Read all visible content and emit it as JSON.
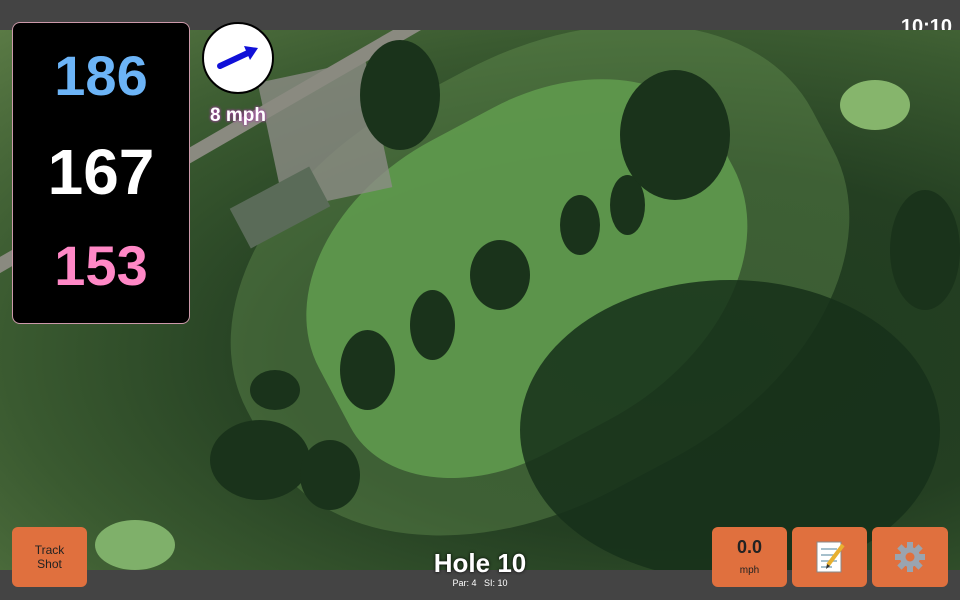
{
  "status": {
    "time": "10:10"
  },
  "yardages": {
    "back": "186",
    "middle": "167",
    "front": "153"
  },
  "wind": {
    "speed": "8 mph",
    "icon": "wind-arrow-icon"
  },
  "hole": {
    "title": "Hole 10",
    "par_label": "Par: 4",
    "si_label": "SI: 10"
  },
  "buttons": {
    "track_shot_line1": "Track",
    "track_shot_line2": "Shot",
    "speed_value": "0.0",
    "speed_unit": "mph",
    "notes_icon": "notepad-icon",
    "settings_icon": "gear-icon"
  },
  "colors": {
    "back": "#6cb4f7",
    "middle": "#ffffff",
    "front": "#ff88c6",
    "button": "#e0703e"
  }
}
